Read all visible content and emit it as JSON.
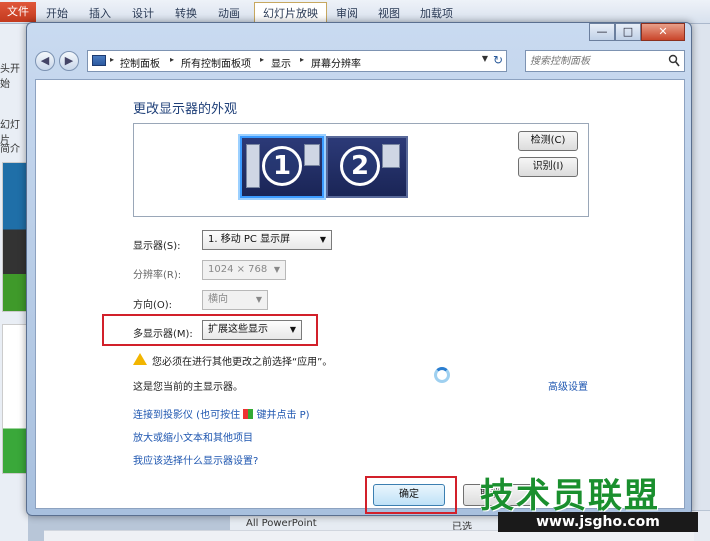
{
  "ppt": {
    "file_tab": "文件",
    "tabs": [
      "开始",
      "插入",
      "设计",
      "转换",
      "动画",
      "幻灯片放映",
      "审阅",
      "视图",
      "加载项"
    ],
    "left_texts": [
      "头开始",
      "幻灯片",
      "简介"
    ],
    "bottom_texts": [
      "All PowerPoint",
      "已选"
    ]
  },
  "window_controls": {
    "minimize": "—",
    "maximize": "□",
    "close": "✕"
  },
  "address": {
    "back": "◀",
    "forward": "▶",
    "crumbs": [
      "控制面板",
      "所有控制面板项",
      "显示",
      "屏幕分辨率"
    ],
    "separator": "▸",
    "dropdown": "▼",
    "refresh": "↻"
  },
  "search": {
    "placeholder": "搜索控制面板"
  },
  "main": {
    "heading": "更改显示器的外观",
    "monitors": [
      "1",
      "2"
    ],
    "detect_button": "检测(C)",
    "identify_button": "识别(I)",
    "display_label": "显示器(S):",
    "display_value": "1. 移动 PC 显示屏",
    "resolution_label": "分辨率(R):",
    "resolution_value": "1024 × 768",
    "orientation_label": "方向(O):",
    "orientation_value": "横向",
    "multi_label": "多显示器(M):",
    "multi_value": "扩展这些显示",
    "arrow": "▼",
    "warning": "您必须在进行其他更改之前选择“应用”。",
    "primary_text": "这是您当前的主显示器。",
    "advanced_link": "高级设置",
    "projector_link_a": "连接到投影仪 (也可按住",
    "projector_link_b": "键并点击 P)",
    "text_size_link": "放大或缩小文本和其他项目",
    "which_display_link": "我应该选择什么显示器设置?"
  },
  "footer": {
    "ok": "确定",
    "cancel": "取消"
  },
  "watermark": {
    "logo_text": "技术员联盟",
    "url": "www.jsgho.com"
  },
  "colors": {
    "highlight_red": "#d2202a",
    "link_blue": "#1e56b0",
    "accent": "#3b9bff"
  }
}
